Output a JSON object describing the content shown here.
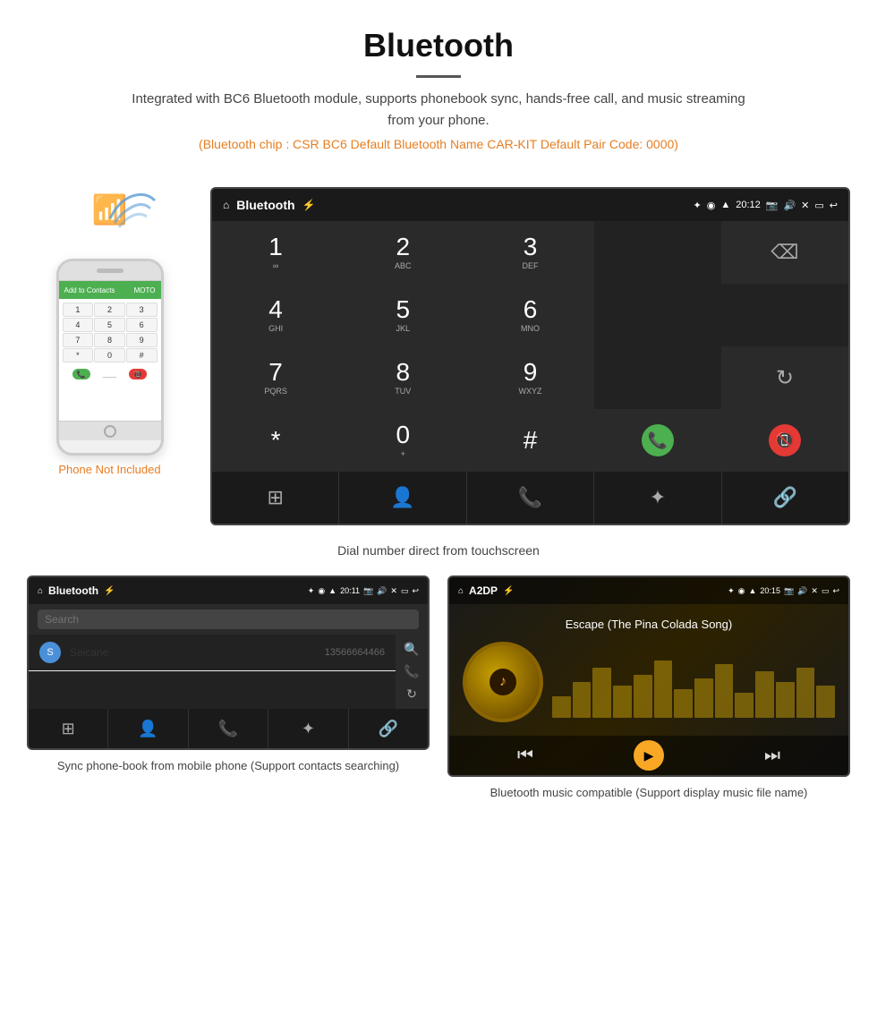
{
  "header": {
    "title": "Bluetooth",
    "subtitle": "Integrated with BC6 Bluetooth module, supports phonebook sync, hands-free call, and music streaming from your phone.",
    "specs": "(Bluetooth chip : CSR BC6    Default Bluetooth Name CAR-KIT    Default Pair Code: 0000)"
  },
  "android_screen": {
    "status_title": "Bluetooth",
    "time": "20:12",
    "dialpad": {
      "keys": [
        {
          "main": "1",
          "sub": ""
        },
        {
          "main": "2",
          "sub": "ABC"
        },
        {
          "main": "3",
          "sub": "DEF"
        },
        {
          "main": "",
          "sub": ""
        },
        {
          "main": "⌫",
          "sub": ""
        },
        {
          "main": "4",
          "sub": "GHI"
        },
        {
          "main": "5",
          "sub": "JKL"
        },
        {
          "main": "6",
          "sub": "MNO"
        },
        {
          "main": "",
          "sub": ""
        },
        {
          "main": "",
          "sub": ""
        },
        {
          "main": "7",
          "sub": "PQRS"
        },
        {
          "main": "8",
          "sub": "TUV"
        },
        {
          "main": "9",
          "sub": "WXYZ"
        },
        {
          "main": "",
          "sub": ""
        },
        {
          "main": "↻",
          "sub": ""
        },
        {
          "main": "*",
          "sub": ""
        },
        {
          "main": "0",
          "sub": "+"
        },
        {
          "main": "#",
          "sub": ""
        },
        {
          "main": "📞green",
          "sub": ""
        },
        {
          "main": "📞red",
          "sub": ""
        }
      ],
      "bottom_nav": [
        "⊞",
        "👤",
        "📞",
        "✦",
        "🔗"
      ]
    }
  },
  "caption_main": "Dial number direct from touchscreen",
  "phone_not_included": "Phone Not Included",
  "phonebook_screen": {
    "status_title": "Bluetooth",
    "time": "20:11",
    "search_placeholder": "Search",
    "contact": {
      "letter": "S",
      "name": "Seicane",
      "phone": "13566664466"
    },
    "right_icons": [
      "🔍",
      "📞",
      "↻"
    ],
    "bottom_nav": [
      "⊞",
      "👤",
      "📞",
      "✦",
      "🔗"
    ]
  },
  "music_screen": {
    "status_title": "A2DP",
    "time": "20:15",
    "song_title": "Escape (The Pina Colada Song)",
    "spectrum_bars": [
      30,
      50,
      70,
      45,
      60,
      80,
      40,
      55,
      75,
      35,
      65,
      50,
      70,
      45
    ],
    "controls": [
      "⏮",
      "⏯",
      "⏭"
    ]
  },
  "caption_phonebook": "Sync phone-book from mobile phone\n(Support contacts searching)",
  "caption_music": "Bluetooth music compatible\n(Support display music file name)"
}
